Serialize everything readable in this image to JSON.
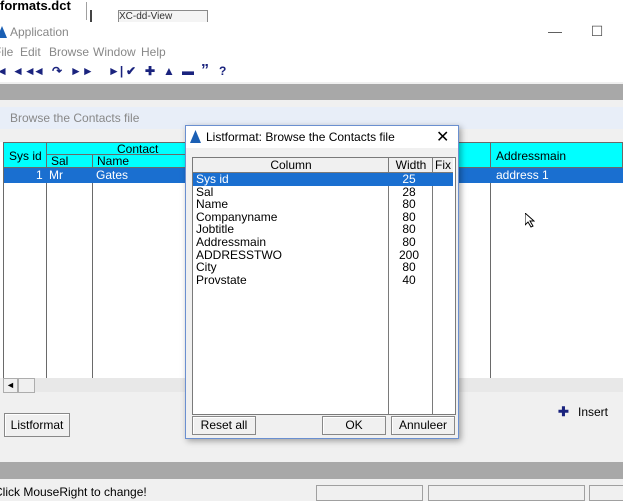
{
  "top": {
    "tab_text": "formats.dct",
    "tabbox_text": "XC-dd-View"
  },
  "window": {
    "title": "Application",
    "minimize": "—",
    "maximize": "☐"
  },
  "menu": {
    "items": [
      "File",
      "Edit",
      "Browse",
      "Window",
      "Help"
    ]
  },
  "toolbar": {
    "icons": [
      "◄",
      "◄◄",
      "◄",
      "↷",
      "►►",
      "►|",
      "✔",
      "✚",
      "▲",
      "▬",
      "”",
      "?"
    ]
  },
  "browse": {
    "title": "Browse the Contacts file",
    "columns": {
      "sysid": "Sys id",
      "contact": "Contact",
      "sal": "Sal",
      "name": "Name",
      "addressmain": "Addressmain"
    },
    "selected_row": {
      "sysid": "1",
      "sal": "Mr",
      "name": "Gates",
      "addressmain": "address 1"
    },
    "scroll_left": "◄"
  },
  "buttons": {
    "listformat": "Listformat",
    "insert": "Insert"
  },
  "status": {
    "text": "Click MouseRight to change!"
  },
  "dialog": {
    "title": "Listformat: Browse the Contacts file",
    "close": "✕",
    "headers": {
      "column": "Column",
      "width": "Width",
      "fix": "Fix"
    },
    "rows": [
      {
        "column": "Sys id",
        "width": "25"
      },
      {
        "column": "Sal",
        "width": "28"
      },
      {
        "column": "Name",
        "width": "80"
      },
      {
        "column": "Companyname",
        "width": "80"
      },
      {
        "column": "Jobtitle",
        "width": "80"
      },
      {
        "column": "Addressmain",
        "width": "80"
      },
      {
        "column": "ADDRESSTWO",
        "width": "200"
      },
      {
        "column": "City",
        "width": "80"
      },
      {
        "column": "Provstate",
        "width": "40"
      }
    ],
    "buttons": {
      "reset": "Reset all",
      "ok": "OK",
      "cancel": "Annuleer"
    }
  },
  "colors": {
    "header_cyan": "#00ffff",
    "selection_blue": "#1a6fd0",
    "gray_band": "#a8a8a8"
  }
}
